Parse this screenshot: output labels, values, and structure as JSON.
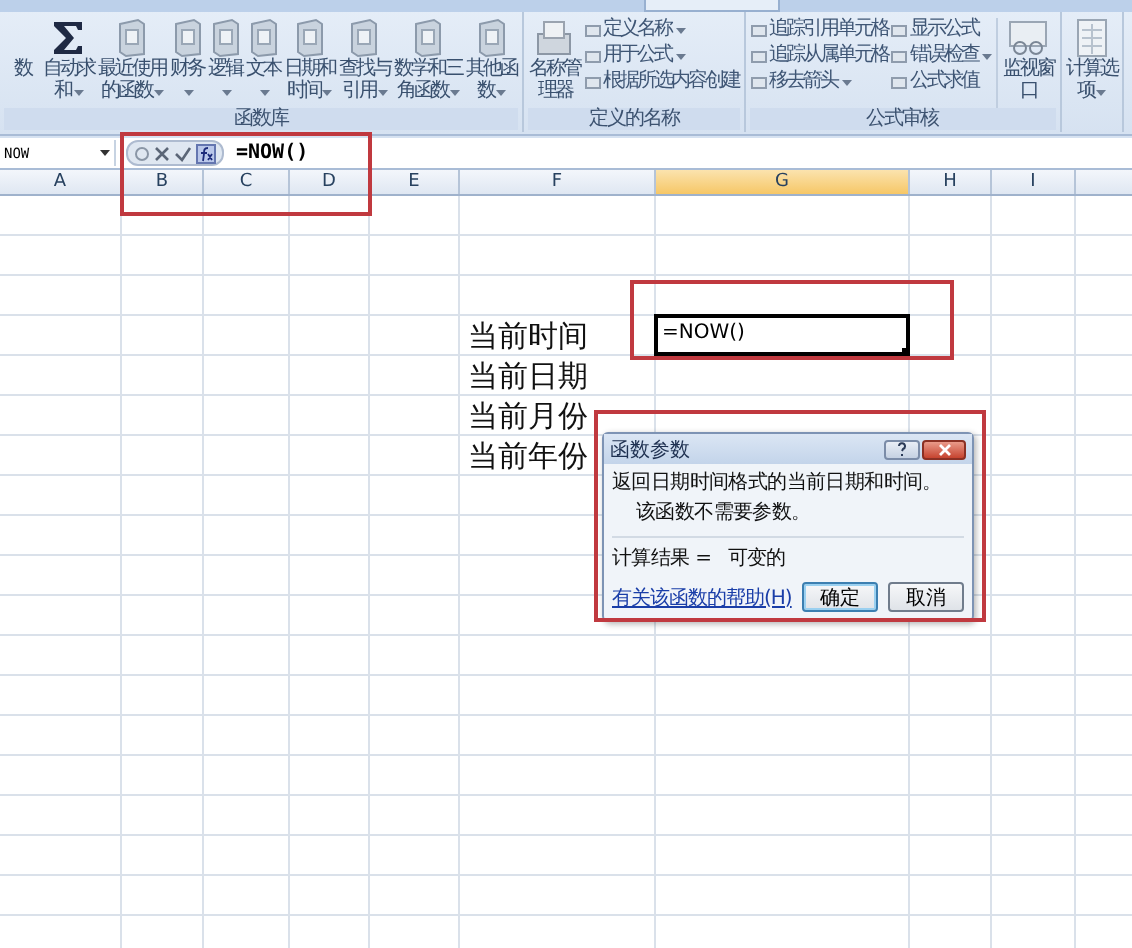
{
  "ribbon": {
    "groups": [
      {
        "title": "函数库",
        "large": [
          {
            "label": "数",
            "kind": "fragment",
            "dropdown": false
          },
          {
            "label": "自动求和",
            "kind": "sum",
            "dropdown": true
          },
          {
            "label": "最近使用的函数",
            "kind": "book",
            "dropdown": true
          },
          {
            "label": "财务",
            "kind": "book",
            "dropdown": true
          },
          {
            "label": "逻辑",
            "kind": "book",
            "dropdown": true
          },
          {
            "label": "文本",
            "kind": "book",
            "dropdown": true
          },
          {
            "label": "日期和时间",
            "kind": "book",
            "dropdown": true
          },
          {
            "label": "查找与引用",
            "kind": "book",
            "dropdown": true
          },
          {
            "label": "数学和三角函数",
            "kind": "book",
            "dropdown": true
          },
          {
            "label": "其他函数",
            "kind": "book",
            "dropdown": true
          }
        ]
      },
      {
        "title": "定义的名称",
        "large": [
          {
            "label": "名称管理器",
            "kind": "names",
            "dropdown": false
          }
        ],
        "small": [
          [
            {
              "label": "定义名称",
              "dropdown": true
            },
            {
              "label": "用于公式",
              "dropdown": true
            },
            {
              "label": "根据所选内容创建",
              "dropdown": false
            }
          ]
        ]
      },
      {
        "title": "公式审核",
        "small": [
          [
            {
              "label": "追踪引用单元格",
              "dropdown": false
            },
            {
              "label": "追踪从属单元格",
              "dropdown": false
            },
            {
              "label": "移去箭头",
              "dropdown": true
            }
          ],
          [
            {
              "label": "显示公式",
              "dropdown": false
            },
            {
              "label": "错误检查",
              "dropdown": true
            },
            {
              "label": "公式求值",
              "dropdown": false
            }
          ]
        ],
        "after": [
          {
            "label": "监视窗口",
            "kind": "watch",
            "dropdown": false
          }
        ]
      },
      {
        "large": [
          {
            "label": "计算选项",
            "kind": "calc",
            "dropdown": true
          }
        ]
      }
    ]
  },
  "formula_bar": {
    "name_box": "NOW",
    "formula": "=NOW()"
  },
  "sheet": {
    "columns": [
      {
        "label": "A",
        "selected": false
      },
      {
        "label": "B",
        "selected": false
      },
      {
        "label": "C",
        "selected": false
      },
      {
        "label": "D",
        "selected": false
      },
      {
        "label": "E",
        "selected": false
      },
      {
        "label": "F",
        "selected": false
      },
      {
        "label": "G",
        "selected": true
      },
      {
        "label": "H",
        "selected": false
      },
      {
        "label": "I",
        "selected": false
      }
    ],
    "labels": [
      "当前时间",
      "当前日期",
      "当前月份",
      "当前年份"
    ],
    "active_cell": {
      "value": "=NOW()"
    }
  },
  "dialog": {
    "title": "函数参数",
    "description": "返回日期时间格式的当前日期和时间。",
    "note": "该函数不需要参数。",
    "result_label": "计算结果 =",
    "result_value": "可变的",
    "help_link": "有关该函数的帮助(H)",
    "buttons": [
      "确定",
      "取消"
    ]
  }
}
